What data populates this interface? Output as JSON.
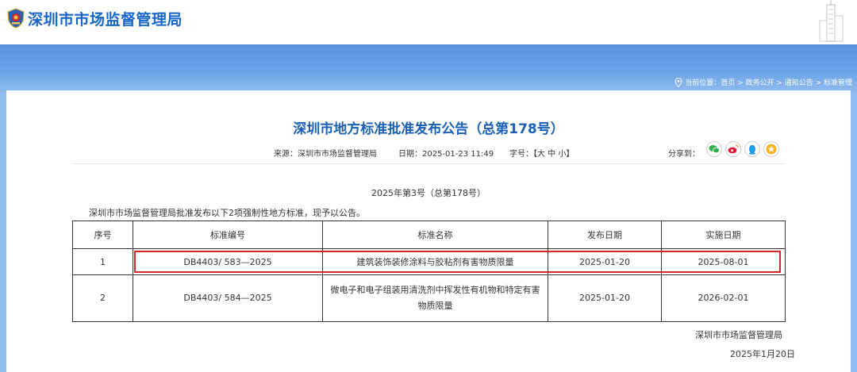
{
  "header": {
    "site_title": "深圳市市场监督管理局"
  },
  "breadcrumb": {
    "text": "当前位置：首页 > 政务公开 > 通知公告 > 标准管理"
  },
  "notice": {
    "title": "深圳市地方标准批准发布公告（总第178号）",
    "source": "来源：深圳市市场监督管理局",
    "date": "日期：2025-01-23 11:49",
    "font_size": "字号：【大  中  小】",
    "share_label": "分享到："
  },
  "share_icons": [
    "wechat-icon",
    "weibo-icon",
    "qq-icon",
    "favorite-icon"
  ],
  "colors": {
    "title_blue": "#1a5fb6",
    "band_blue": "#6aa3e6",
    "highlight_red": "#d9262b"
  },
  "body": {
    "subtitle": "2025年第3号（总第178号）",
    "intro": "深圳市市场监督管理局批准发布以下2项强制性地方标准，现予以公告。"
  },
  "table": {
    "headers": [
      "序号",
      "标准编号",
      "标准名称",
      "发布日期",
      "实施日期"
    ],
    "rows": [
      [
        "1",
        "DB4403/ 583—2025",
        "建筑装饰装修涂料与胶粘剂有害物质限量",
        "2025-01-20",
        "2025-08-01"
      ],
      [
        "2",
        "DB4403/ 584—2025",
        "微电子和电子组装用清洗剂中挥发性有机物和特定有害物质限量",
        "2025-01-20",
        "2026-02-01"
      ]
    ]
  },
  "signature": {
    "org": "深圳市市场监督管理局",
    "date": "2025年1月20日"
  }
}
